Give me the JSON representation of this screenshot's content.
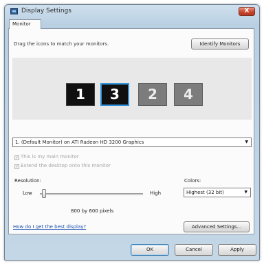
{
  "window": {
    "title": "Display Settings",
    "close_label": "X"
  },
  "tabs": [
    {
      "label": "Monitor"
    }
  ],
  "monitor_tab": {
    "hint": "Drag the icons to match your monitors.",
    "identify_label": "Identify Monitors",
    "monitors": [
      {
        "number": "1",
        "state": "active"
      },
      {
        "number": "3",
        "state": "selected"
      },
      {
        "number": "2",
        "state": "inactive"
      },
      {
        "number": "4",
        "state": "inactive"
      }
    ],
    "monitor_select": "1. (Default Monitor) on ATI Radeon HD 3200 Graphics",
    "option_main_monitor": "This is my main monitor",
    "option_extend_desktop": "Extend the desktop onto this monitor",
    "resolution_label": "Resolution:",
    "low_label": "Low",
    "high_label": "High",
    "resolution_value": "800 by 600 pixels",
    "resolution_slider_level": 0.02,
    "colors_label": "Colors:",
    "colors_select": "Highest (32 bit)",
    "help_link": "How do I get the best display?",
    "advanced_label": "Advanced Settings..."
  },
  "footer": {
    "ok_label": "OK",
    "cancel_label": "Cancel",
    "apply_label": "Apply"
  }
}
